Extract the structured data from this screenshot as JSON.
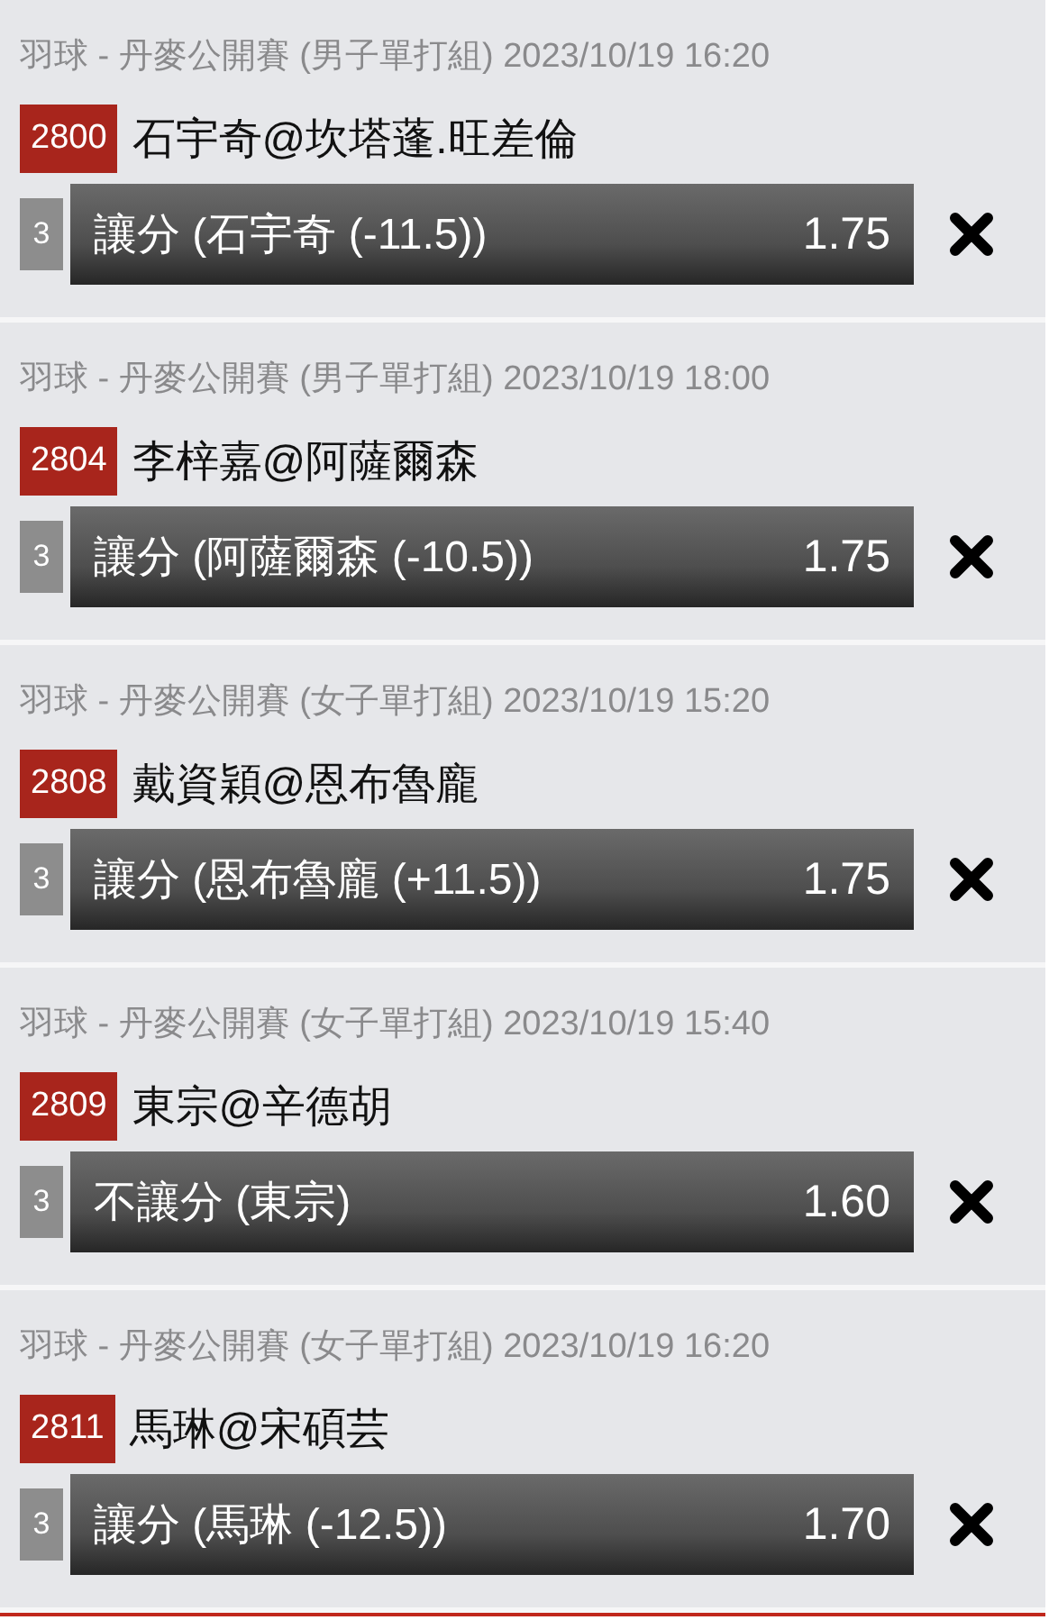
{
  "bets": [
    {
      "header": "羽球 - 丹麥公開賽 (男子單打組) 2023/10/19 16:20",
      "code": "2800",
      "match": "石宇奇@坎塔蓬.旺差倫",
      "leg": "3",
      "selection": "讓分 (石宇奇 (-11.5))",
      "odds": "1.75"
    },
    {
      "header": "羽球 - 丹麥公開賽 (男子單打組) 2023/10/19 18:00",
      "code": "2804",
      "match": "李梓嘉@阿薩爾森",
      "leg": "3",
      "selection": "讓分 (阿薩爾森 (-10.5))",
      "odds": "1.75"
    },
    {
      "header": "羽球 - 丹麥公開賽 (女子單打組) 2023/10/19 15:20",
      "code": "2808",
      "match": "戴資穎@恩布魯龐",
      "leg": "3",
      "selection": "讓分 (恩布魯龐 (+11.5))",
      "odds": "1.75"
    },
    {
      "header": "羽球 - 丹麥公開賽 (女子單打組) 2023/10/19 15:40",
      "code": "2809",
      "match": "東宗@辛德胡",
      "leg": "3",
      "selection": "不讓分 (東宗)",
      "odds": "1.60"
    },
    {
      "header": "羽球 - 丹麥公開賽 (女子單打組) 2023/10/19 16:20",
      "code": "2811",
      "match": "馬琳@宋碩芸",
      "leg": "3",
      "selection": "讓分 (馬琳 (-12.5))",
      "odds": "1.70"
    }
  ]
}
